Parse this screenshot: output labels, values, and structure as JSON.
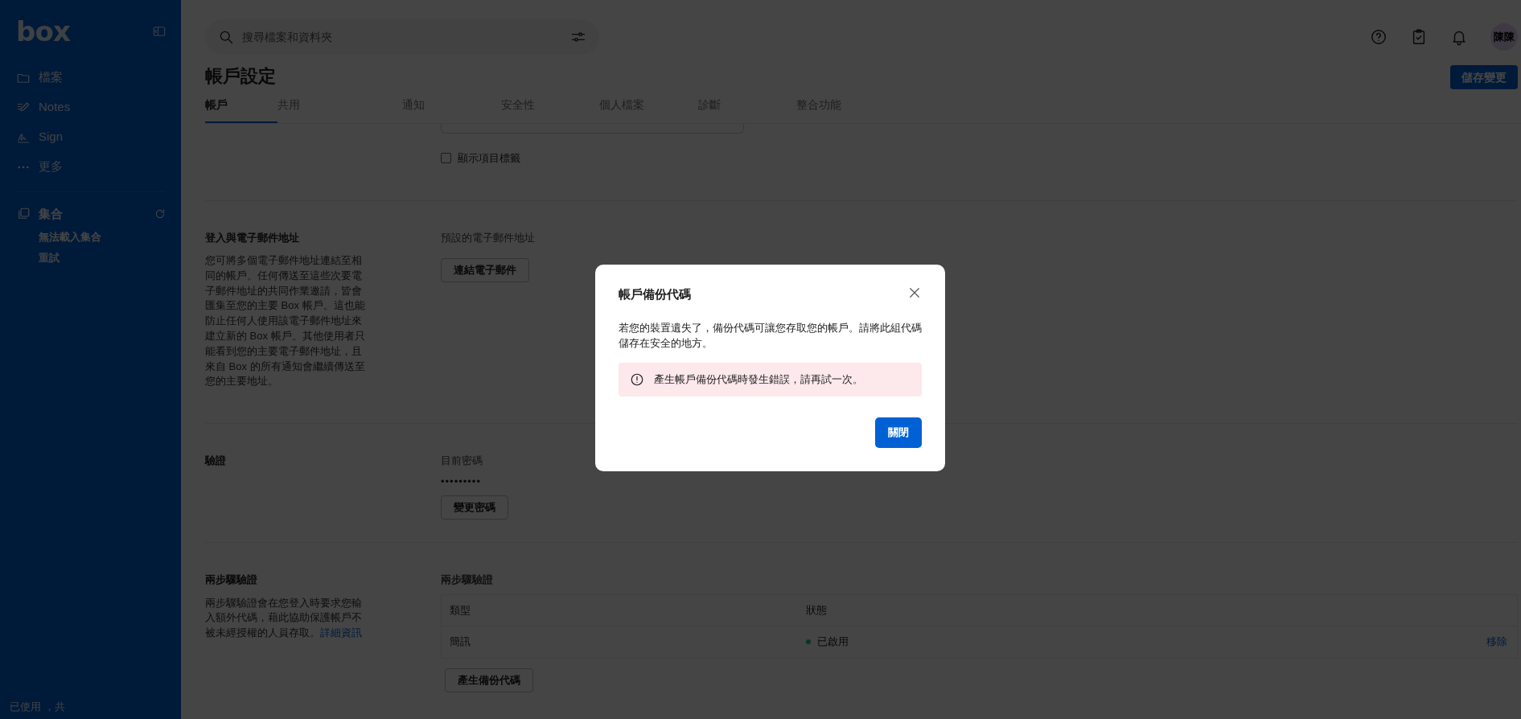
{
  "sidebar": {
    "logo": "box",
    "nav": [
      {
        "label": "檔案",
        "kind": "folder"
      },
      {
        "label": "Notes",
        "kind": "notes"
      },
      {
        "label": "Sign",
        "kind": "sign"
      },
      {
        "label": "更多",
        "kind": "more"
      }
    ],
    "collections": {
      "title": "集合",
      "error": "無法載入集合",
      "retry": "重試"
    },
    "footer": "已使用 ，共"
  },
  "search": {
    "placeholder": "搜尋檔案和資料夾"
  },
  "header": {
    "title": "帳戶設定",
    "save_button": "儲存變更",
    "avatar": "陳陳"
  },
  "tabs": [
    {
      "label": "帳戶",
      "selected": true
    },
    {
      "label": "共用",
      "selected": false
    },
    {
      "label": "通知",
      "selected": false
    },
    {
      "label": "安全性",
      "selected": false
    },
    {
      "label": "個人檔案",
      "selected": false
    },
    {
      "label": "診斷",
      "selected": false
    },
    {
      "label": "整合功能",
      "selected": false
    }
  ],
  "display_option": {
    "label": "顯示項目標籤",
    "checked": false
  },
  "email_section": {
    "title": "登入與電子郵件地址",
    "description": "您可將多個電子郵件地址連結至相同的帳戶。任何傳送至這些次要電子郵件地址的共同作業邀請，皆會匯集至您的主要 Box 帳戶。這也能防止任何人使用該電子郵件地址來建立新的 Box 帳戶。其他使用者只能看到您的主要電子郵件地址，且來自 Box 的所有通知會繼續傳送至您的主要地址。",
    "field_label": "預設的電子郵件地址",
    "button": "連結電子郵件"
  },
  "verification": {
    "title": "驗證",
    "field_label": "目前密碼",
    "password": "•••••••••",
    "button": "變更密碼"
  },
  "two_step": {
    "title": "兩步驟驗證",
    "description": "兩步驟驗證會在您登入時要求您輸入額外代碼，藉此協助保護帳戶不被未經授權的人員存取。",
    "link": "詳細資訊",
    "field_label": "兩步驟驗證",
    "columns": [
      "類型",
      "狀態"
    ],
    "rows": [
      {
        "type": "簡訊",
        "status": "已啟用",
        "action": "移除"
      }
    ],
    "button": "產生備份代碼"
  },
  "dialog": {
    "title": "帳戶備份代碼",
    "body": "若您的裝置遺失了，備份代碼可讓您存取您的帳戶。請將此組代碼儲存在安全的地方。",
    "error": "產生帳戶備份代碼時發生錯誤，請再試一次。",
    "close_button": "關閉"
  }
}
